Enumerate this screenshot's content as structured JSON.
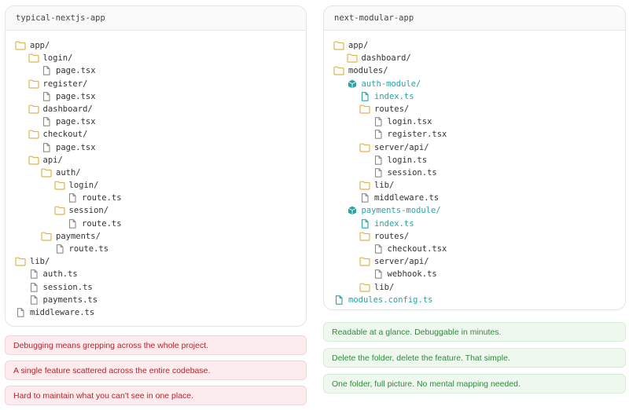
{
  "left": {
    "title": "typical-nextjs-app",
    "tree": [
      {
        "name": "app/",
        "type": "folder",
        "depth": 0
      },
      {
        "name": "login/",
        "type": "folder",
        "depth": 1
      },
      {
        "name": "page.tsx",
        "type": "file",
        "depth": 2
      },
      {
        "name": "register/",
        "type": "folder",
        "depth": 1
      },
      {
        "name": "page.tsx",
        "type": "file",
        "depth": 2
      },
      {
        "name": "dashboard/",
        "type": "folder",
        "depth": 1
      },
      {
        "name": "page.tsx",
        "type": "file",
        "depth": 2
      },
      {
        "name": "checkout/",
        "type": "folder",
        "depth": 1
      },
      {
        "name": "page.tsx",
        "type": "file",
        "depth": 2
      },
      {
        "name": "api/",
        "type": "folder",
        "depth": 1
      },
      {
        "name": "auth/",
        "type": "folder",
        "depth": 2
      },
      {
        "name": "login/",
        "type": "folder",
        "depth": 3
      },
      {
        "name": "route.ts",
        "type": "file",
        "depth": 4
      },
      {
        "name": "session/",
        "type": "folder",
        "depth": 3
      },
      {
        "name": "route.ts",
        "type": "file",
        "depth": 4
      },
      {
        "name": "payments/",
        "type": "folder",
        "depth": 2
      },
      {
        "name": "route.ts",
        "type": "file",
        "depth": 3
      },
      {
        "name": "lib/",
        "type": "folder",
        "depth": 0
      },
      {
        "name": "auth.ts",
        "type": "file",
        "depth": 1
      },
      {
        "name": "session.ts",
        "type": "file",
        "depth": 1
      },
      {
        "name": "payments.ts",
        "type": "file",
        "depth": 1
      },
      {
        "name": "middleware.ts",
        "type": "file",
        "depth": 0
      }
    ],
    "notes": [
      "Debugging means grepping across the whole project.",
      "A single feature scattered across the entire codebase.",
      "Hard to maintain what you can't see in one place."
    ]
  },
  "right": {
    "title": "next-modular-app",
    "tree": [
      {
        "name": "app/",
        "type": "folder",
        "depth": 0
      },
      {
        "name": "dashboard/",
        "type": "folder",
        "depth": 1
      },
      {
        "name": "modules/",
        "type": "folder",
        "depth": 0
      },
      {
        "name": "auth-module/",
        "type": "module",
        "depth": 1
      },
      {
        "name": "index.ts",
        "type": "file-teal",
        "depth": 2
      },
      {
        "name": "routes/",
        "type": "folder",
        "depth": 2
      },
      {
        "name": "login.tsx",
        "type": "file",
        "depth": 3
      },
      {
        "name": "register.tsx",
        "type": "file",
        "depth": 3
      },
      {
        "name": "server/api/",
        "type": "folder",
        "depth": 2
      },
      {
        "name": "login.ts",
        "type": "file",
        "depth": 3
      },
      {
        "name": "session.ts",
        "type": "file",
        "depth": 3
      },
      {
        "name": "lib/",
        "type": "folder",
        "depth": 2
      },
      {
        "name": "middleware.ts",
        "type": "file",
        "depth": 2
      },
      {
        "name": "payments-module/",
        "type": "module",
        "depth": 1
      },
      {
        "name": "index.ts",
        "type": "file-teal",
        "depth": 2
      },
      {
        "name": "routes/",
        "type": "folder",
        "depth": 2
      },
      {
        "name": "checkout.tsx",
        "type": "file",
        "depth": 3
      },
      {
        "name": "server/api/",
        "type": "folder",
        "depth": 2
      },
      {
        "name": "webhook.ts",
        "type": "file",
        "depth": 3
      },
      {
        "name": "lib/",
        "type": "folder",
        "depth": 2
      },
      {
        "name": "modules.config.ts",
        "type": "file-teal",
        "depth": 0
      }
    ],
    "notes": [
      "Readable at a glance. Debuggable in minutes.",
      "Delete the folder, delete the feature. That simple.",
      "One folder, full picture. No mental mapping needed."
    ]
  },
  "colors": {
    "folder": "#e0b54d",
    "file": "#8a8a8a",
    "teal": "#2ba3a3",
    "bad_text": "#b4232c",
    "good_text": "#2f8a3b"
  }
}
